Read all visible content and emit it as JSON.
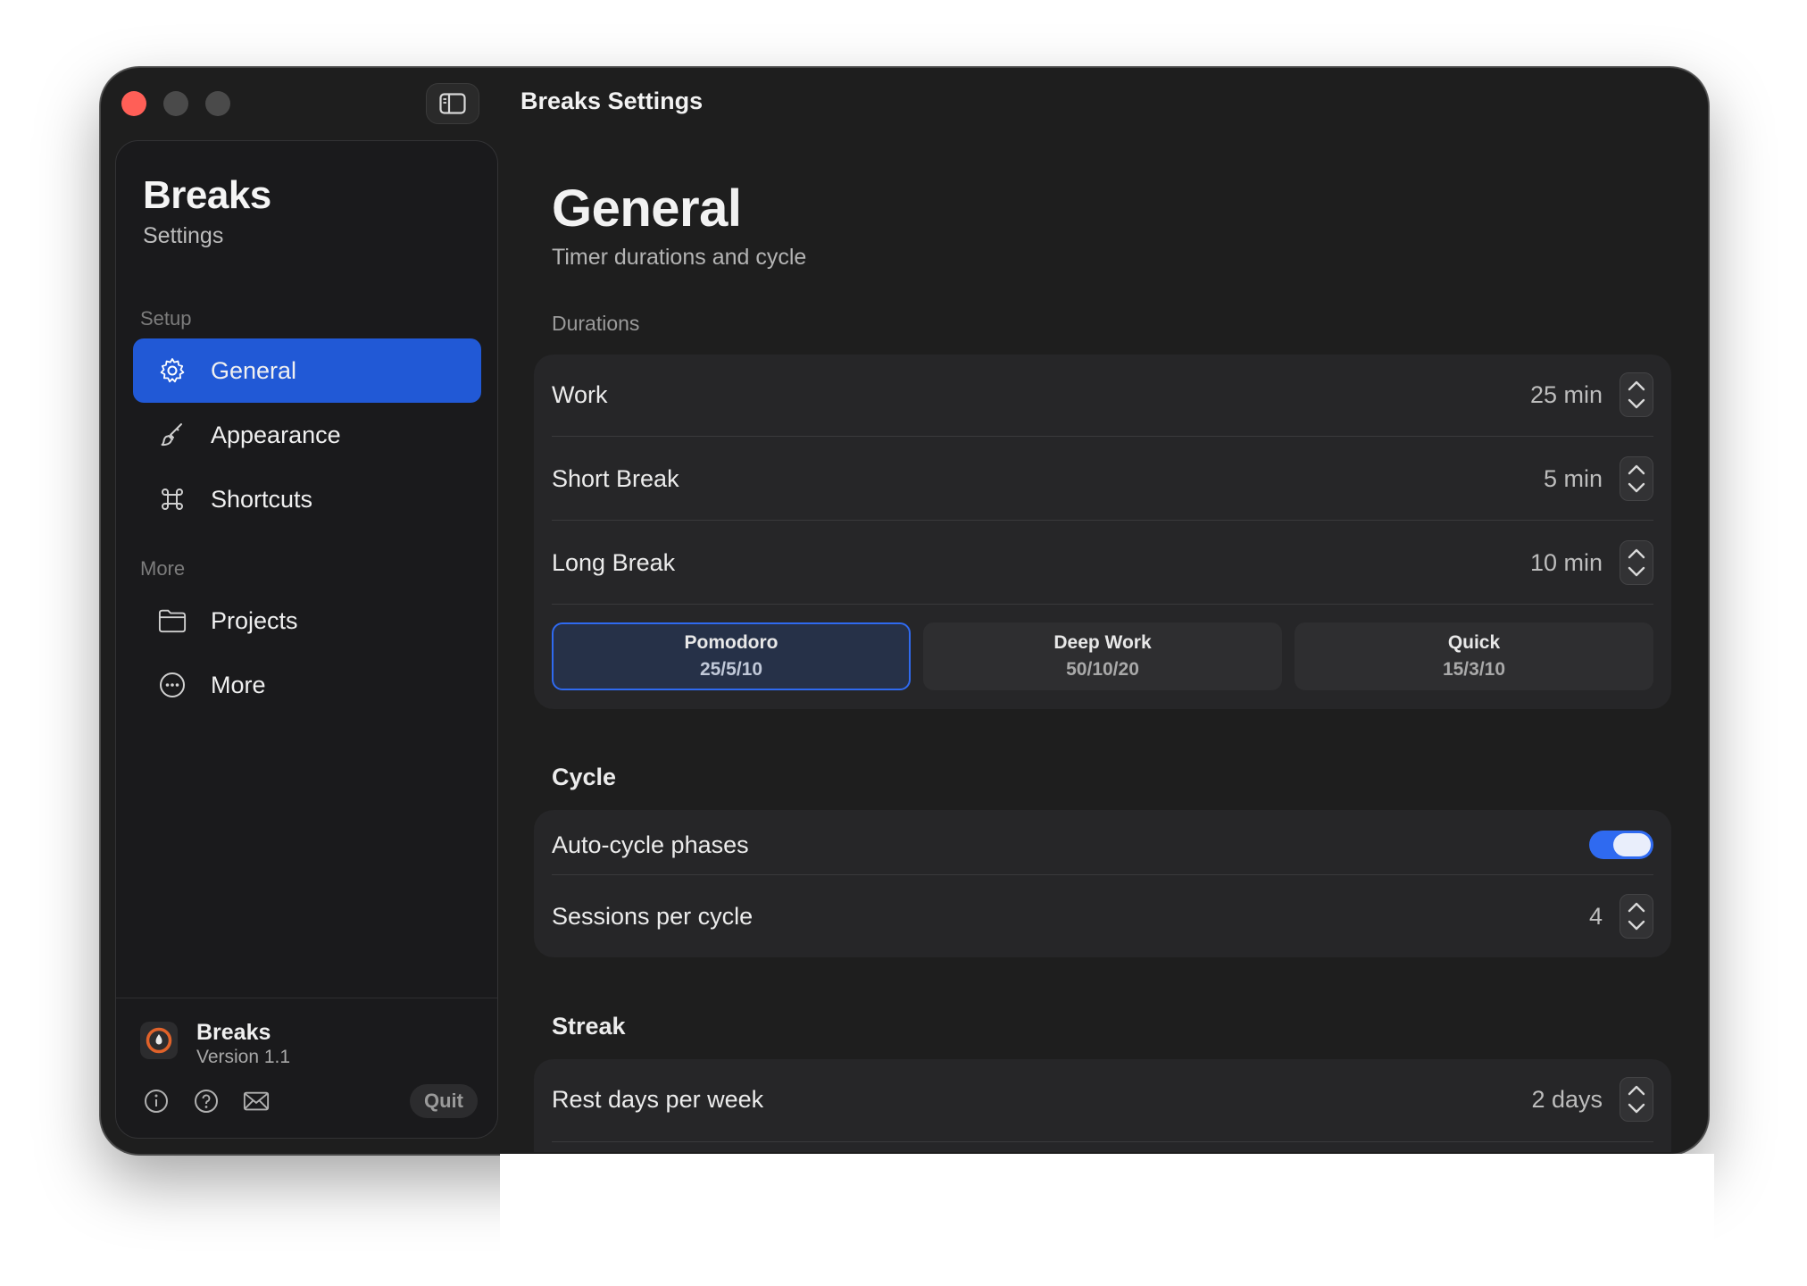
{
  "window": {
    "title": "Breaks Settings"
  },
  "sidebar": {
    "app_title": "Breaks",
    "app_subtitle": "Settings",
    "sections": [
      {
        "label": "Setup"
      },
      {
        "label": "More"
      }
    ],
    "items": [
      {
        "label": "General",
        "icon": "gear-icon",
        "active": true
      },
      {
        "label": "Appearance",
        "icon": "paintbrush-icon",
        "active": false
      },
      {
        "label": "Shortcuts",
        "icon": "command-icon",
        "active": false
      },
      {
        "label": "Projects",
        "icon": "folder-icon",
        "active": false
      },
      {
        "label": "More",
        "icon": "ellipsis-circle-icon",
        "active": false
      }
    ],
    "footer": {
      "app_name": "Breaks",
      "version": "Version 1.1",
      "quit_label": "Quit"
    }
  },
  "main": {
    "title": "General",
    "subtitle": "Timer durations and cycle",
    "durations": {
      "label": "Durations",
      "rows": [
        {
          "label": "Work",
          "value": "25 min"
        },
        {
          "label": "Short Break",
          "value": "5 min"
        },
        {
          "label": "Long Break",
          "value": "10 min"
        }
      ],
      "presets": [
        {
          "name": "Pomodoro",
          "value": "25/5/10",
          "selected": true
        },
        {
          "name": "Deep Work",
          "value": "50/10/20",
          "selected": false
        },
        {
          "name": "Quick",
          "value": "15/3/10",
          "selected": false
        }
      ]
    },
    "cycle": {
      "heading": "Cycle",
      "auto_cycle_label": "Auto-cycle phases",
      "auto_cycle_on": true,
      "sessions_label": "Sessions per cycle",
      "sessions_value": "4"
    },
    "streak": {
      "heading": "Streak",
      "rest_days_label": "Rest days per week",
      "rest_days_value": "2 days"
    }
  },
  "colors": {
    "accent": "#2159d6",
    "close": "#ff5f57",
    "toggle_on": "#2f6af0"
  }
}
